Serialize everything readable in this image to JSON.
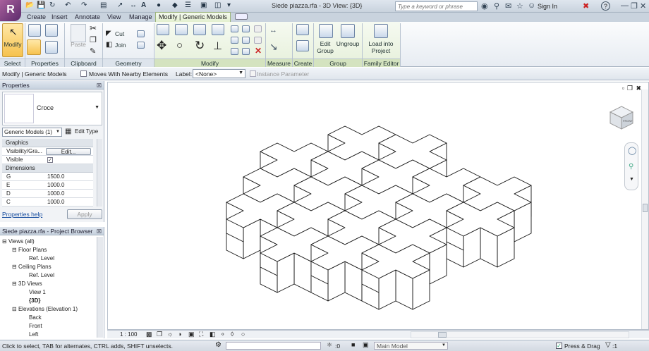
{
  "app": {
    "logo": "R",
    "doc_title": "Siede piazza.rfa - 3D View: {3D}"
  },
  "quick_access": {
    "text_icon": "A"
  },
  "search": {
    "placeholder": "Type a keyword or phrase"
  },
  "title_tools": {
    "sign_in": "Sign In",
    "help": "?"
  },
  "tabs": [
    "Create",
    "Insert",
    "Annotate",
    "View",
    "Manage"
  ],
  "active_tab": "Modify | Generic Models",
  "ribbon": {
    "modify_label": "Modify",
    "cut_label": "Cut",
    "join_label": "Join",
    "paste_label": "Paste",
    "edit_group_label": [
      "Edit",
      "Group"
    ],
    "ungroup_label": "Ungroup",
    "load_label": [
      "Load into",
      "Project"
    ],
    "panels": {
      "select": "Select",
      "properties": "Properties",
      "clipboard": "Clipboard",
      "geometry": "Geometry",
      "modify": "Modify",
      "measure": "Measure",
      "create": "Create",
      "group": "Group",
      "family_editor": "Family Editor"
    }
  },
  "options_bar": {
    "context": "Modify | Generic Models",
    "moves_with": "Moves With Nearby Elements",
    "label_caption": "Label:",
    "label_value": "<None>",
    "instance_param": "Instance Parameter"
  },
  "properties": {
    "title": "Properties",
    "type_name": "Croce",
    "category": "Generic Models (1)",
    "edit_type": "Edit Type",
    "group_graphics": "Graphics",
    "vis_label": "Visibility/Gra...",
    "vis_button": "Edit...",
    "visible_label": "Visible",
    "group_dimensions": "Dimensions",
    "dims": [
      {
        "name": "G",
        "value": "1500.0"
      },
      {
        "name": "E",
        "value": "1000.0"
      },
      {
        "name": "D",
        "value": "1000.0"
      },
      {
        "name": "C",
        "value": "1000.0"
      }
    ],
    "help_link": "Properties help",
    "apply": "Apply"
  },
  "project_browser": {
    "title": "Siede piazza.rfa - Project Browser",
    "items": [
      {
        "label": "Views (all)",
        "level": 0,
        "toggle": "⊟"
      },
      {
        "label": "Floor Plans",
        "level": 1,
        "toggle": "⊟"
      },
      {
        "label": "Ref. Level",
        "level": 2,
        "toggle": ""
      },
      {
        "label": "Ceiling Plans",
        "level": 1,
        "toggle": "⊟"
      },
      {
        "label": "Ref. Level",
        "level": 2,
        "toggle": ""
      },
      {
        "label": "3D Views",
        "level": 1,
        "toggle": "⊟"
      },
      {
        "label": "View 1",
        "level": 2,
        "toggle": ""
      },
      {
        "label": "{3D}",
        "level": 2,
        "toggle": "",
        "bold": true
      },
      {
        "label": "Elevations (Elevation 1)",
        "level": 1,
        "toggle": "⊟"
      },
      {
        "label": "Back",
        "level": 2,
        "toggle": ""
      },
      {
        "label": "Front",
        "level": 2,
        "toggle": ""
      },
      {
        "label": "Left",
        "level": 2,
        "toggle": ""
      }
    ]
  },
  "viewcube": {
    "label": "FRONT"
  },
  "view_status": {
    "scale": "1 : 100"
  },
  "status_bar": {
    "message": "Click to select, TAB for alternates, CTRL adds, SHIFT unselects.",
    "count": ":0",
    "model": "Main Model",
    "press_drag": "Press & Drag",
    "filter_count": ":1"
  },
  "colors": {
    "selection": "#6e8fde",
    "ribbon_active": "#e3f0cf"
  }
}
